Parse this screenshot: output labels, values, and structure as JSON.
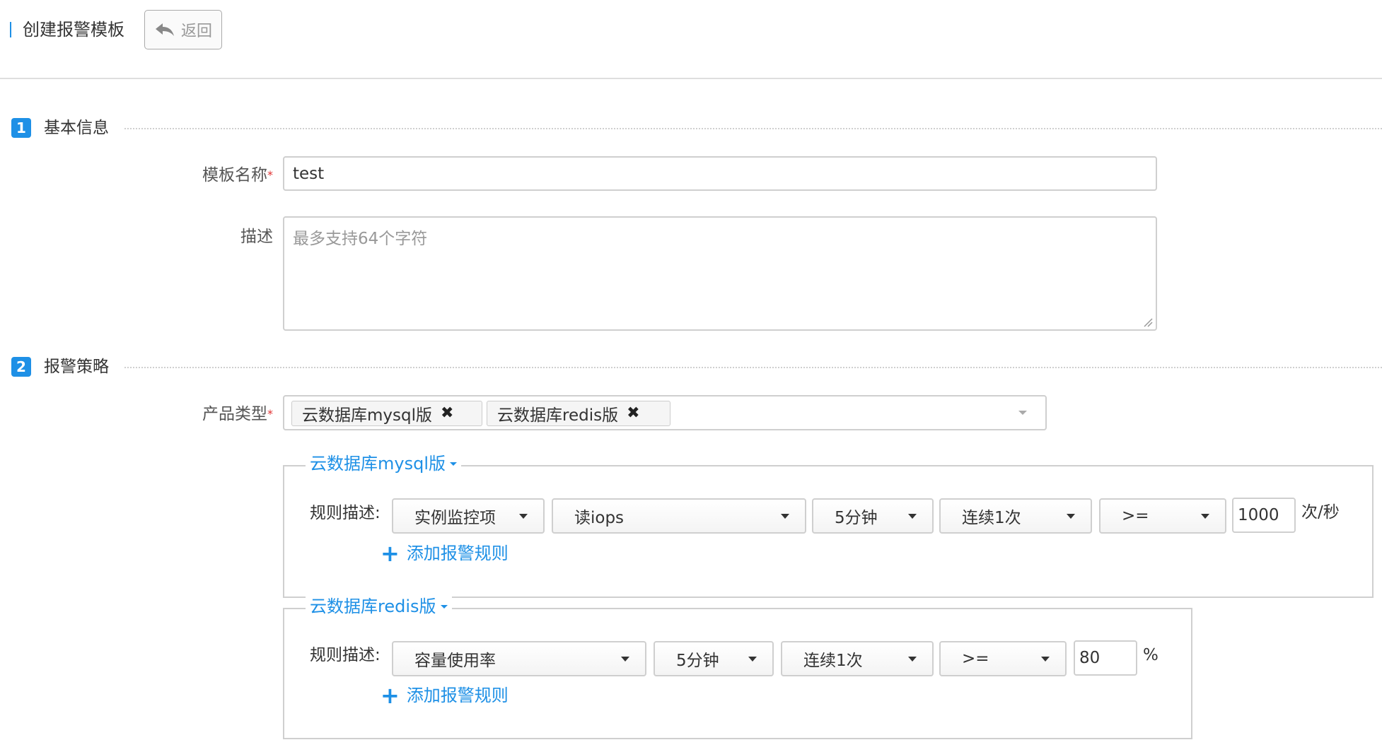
{
  "header": {
    "title": "创建报警模板",
    "back_label": "返回"
  },
  "sections": {
    "basic": {
      "number": "1",
      "title": "基本信息"
    },
    "policy": {
      "number": "2",
      "title": "报警策略"
    }
  },
  "form": {
    "template_name": {
      "label": "模板名称",
      "required_mark": "*",
      "value": "test"
    },
    "description": {
      "label": "描述",
      "placeholder": "最多支持64个字符",
      "value": ""
    },
    "product_type": {
      "label": "产品类型",
      "required_mark": "*",
      "tags": [
        "云数据库mysql版",
        "云数据库redis版"
      ],
      "remove_glyph": "✖"
    }
  },
  "rule_groups": {
    "mysql": {
      "legend": "云数据库mysql版",
      "rule_label": "规则描述:",
      "metric_type": "实例监控项",
      "metric": "读iops",
      "period": "5分钟",
      "times": "连续1次",
      "operator": ">=",
      "threshold": "1000",
      "unit": "次/秒",
      "add_label": "添加报警规则"
    },
    "redis": {
      "legend": "云数据库redis版",
      "rule_label": "规则描述:",
      "metric": "容量使用率",
      "period": "5分钟",
      "times": "连续1次",
      "operator": ">=",
      "threshold": "80",
      "unit": "%",
      "add_label": "添加报警规则"
    }
  },
  "colors": {
    "accent": "#1e90e6",
    "required": "#e03030",
    "border": "#cfcfcf"
  },
  "icons": {
    "back": "reply-arrow-icon",
    "remove": "close-icon",
    "add": "plus-icon"
  }
}
